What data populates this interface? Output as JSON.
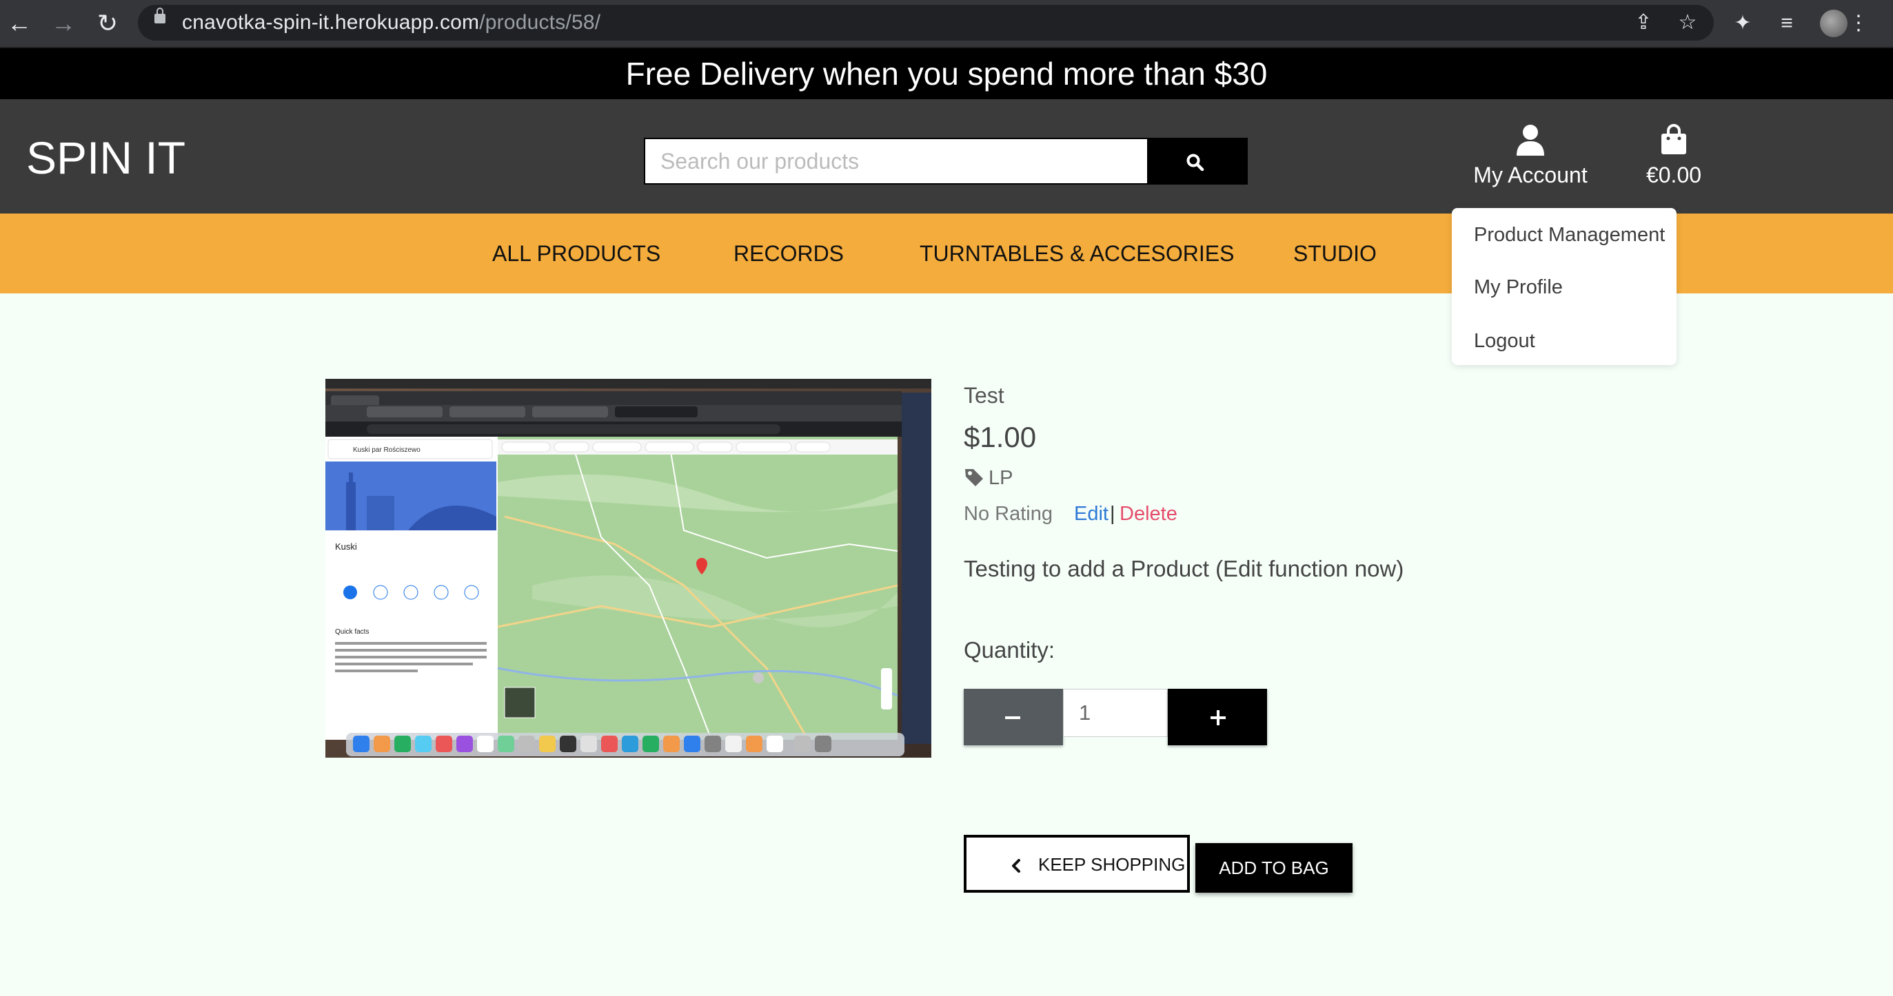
{
  "browser": {
    "url_host": "cnavotka-spin-it.herokuapp.com",
    "url_path": "/products/58/",
    "icons": [
      "back-icon",
      "forward-icon",
      "reload-icon",
      "lock-icon",
      "share-icon",
      "star-icon",
      "extensions-icon",
      "reading-list-icon",
      "profile-avatar",
      "menu-icon"
    ]
  },
  "banner": {
    "text": "Free Delivery when you spend more than $30"
  },
  "header": {
    "logo": "SPIN IT",
    "search_placeholder": "Search our products",
    "account_label": "My Account",
    "bag_total": "€0.00"
  },
  "nav": {
    "items": [
      {
        "label": "ALL PRODUCTS"
      },
      {
        "label": "RECORDS"
      },
      {
        "label": "TURNTABLES & ACCESORIES"
      },
      {
        "label": "STUDIO"
      }
    ]
  },
  "account_menu": {
    "items": [
      {
        "label": "Product Management"
      },
      {
        "label": "My Profile"
      },
      {
        "label": "Logout"
      }
    ]
  },
  "product": {
    "name": "Test",
    "price": "$1.00",
    "category": "LP",
    "rating": "No Rating",
    "edit_label": "Edit",
    "separator": "|",
    "delete_label": "Delete",
    "description": "Testing to add a Product (Edit function now)",
    "quantity_label": "Quantity:",
    "quantity_value": "1",
    "image_alt": "Screenshot of Google Maps showing Kuski, Poland",
    "screenshot_text": {
      "search": "Kuski par Rościszewo",
      "place": "Kuski",
      "quick_facts": "Quick facts"
    }
  },
  "actions": {
    "keep_shopping": "KEEP SHOPPING",
    "add_to_bag": "ADD TO BAG"
  },
  "colors": {
    "banner_bg": "#000000",
    "header_bg": "#3b3b3b",
    "nav_bg": "#f4ac3c",
    "page_bg": "#f5fff8",
    "edit_link": "#2f79d6",
    "delete_link": "#e64c6b"
  }
}
